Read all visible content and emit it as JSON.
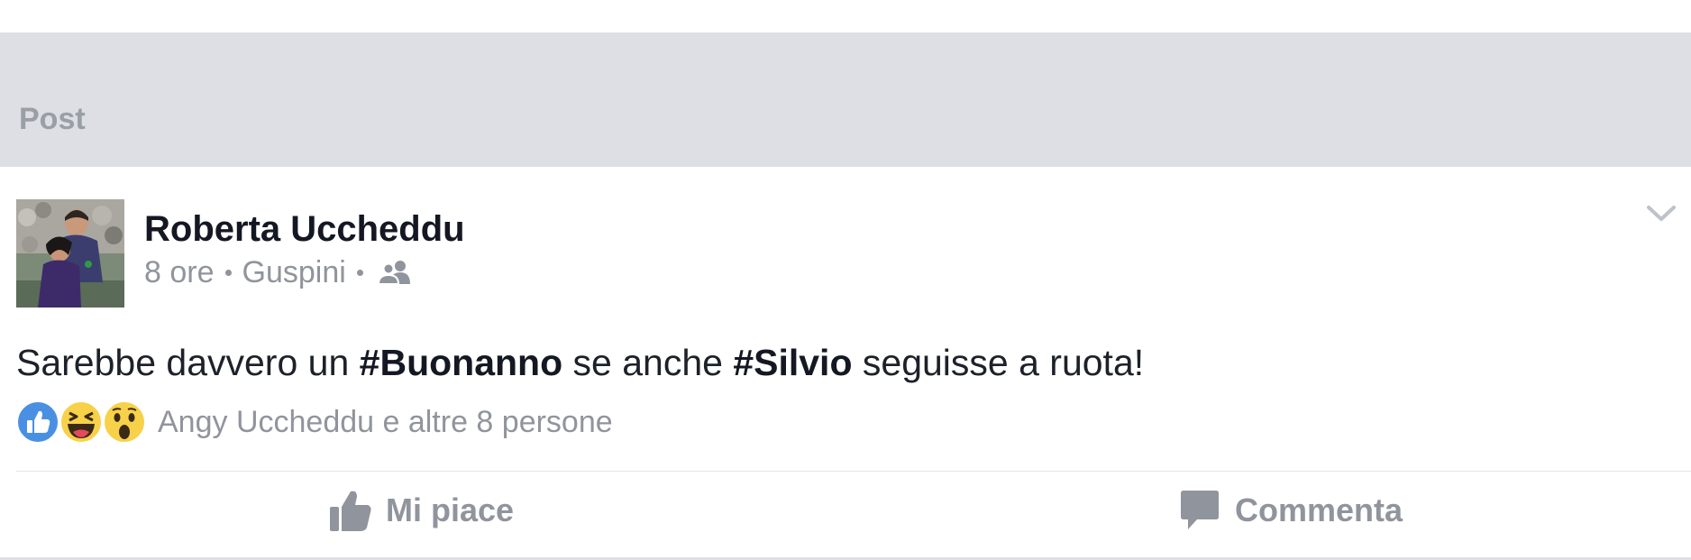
{
  "section": {
    "title": "Post"
  },
  "post": {
    "author": "Roberta Uccheddu",
    "time": "8 ore",
    "location": "Guspini",
    "privacy_icon": "friends-icon",
    "text_parts": [
      {
        "text": "Sarebbe davvero un ",
        "bold": false
      },
      {
        "text": "#Buonanno",
        "bold": true
      },
      {
        "text": " se anche ",
        "bold": false
      },
      {
        "text": "#Silvio",
        "bold": true
      },
      {
        "text": " seguisse a ruota!",
        "bold": false
      }
    ],
    "reactions": [
      "like-reaction-icon",
      "haha-reaction-icon",
      "wow-reaction-icon"
    ],
    "reactors_text": "Angy Uccheddu e altre 8 persone"
  },
  "actions": {
    "like_label": "Mi piace",
    "comment_label": "Commenta"
  },
  "colors": {
    "band": "#dddfe4",
    "muted_text": "#90949c",
    "author_text": "#141823",
    "like_blue": "#4a90e2",
    "emoji_yellow": "#f7d149"
  }
}
